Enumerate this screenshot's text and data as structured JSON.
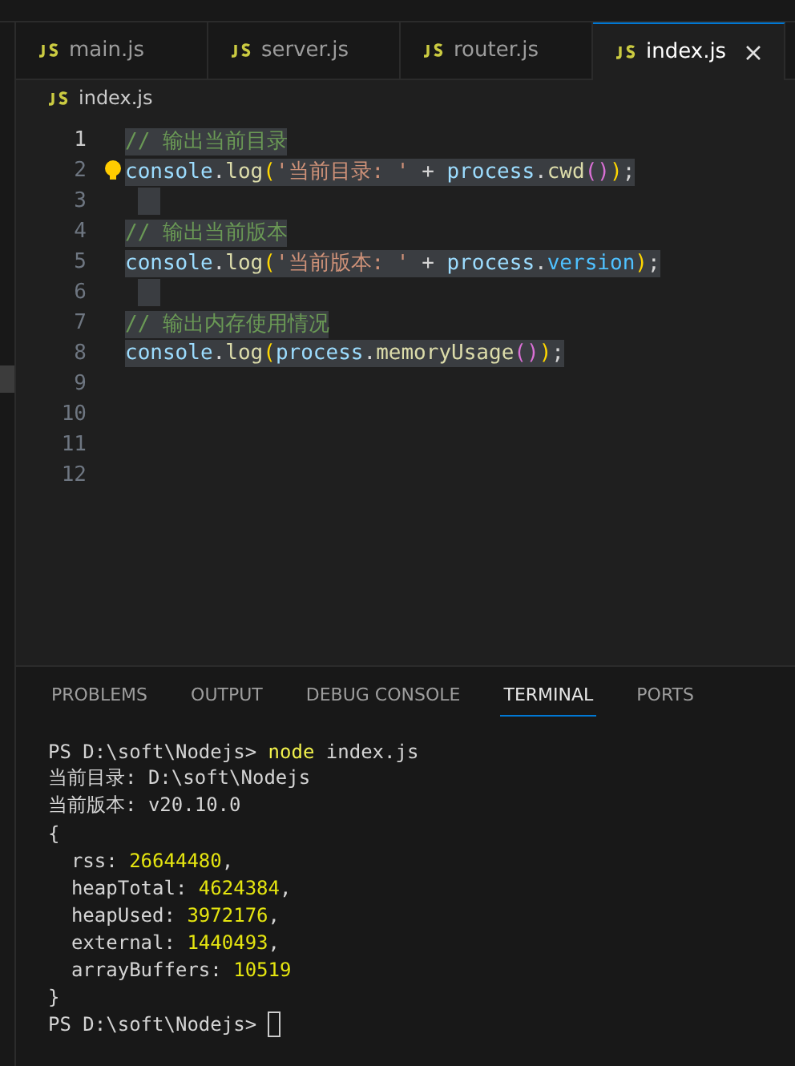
{
  "editor_tabs": [
    {
      "label": "main.js",
      "selected": false
    },
    {
      "label": "server.js",
      "selected": false
    },
    {
      "label": "router.js",
      "selected": false
    },
    {
      "label": "index.js",
      "selected": true
    }
  ],
  "breadcrumb": "index.js",
  "code_lines": [
    {
      "number": "1",
      "current": true,
      "selected": true,
      "tokens": [
        {
          "t": "// 输出当前目录",
          "kind": "comment"
        }
      ]
    },
    {
      "number": "2",
      "current": false,
      "selected": true,
      "lightbulb": true,
      "tokens": [
        {
          "t": "console",
          "kind": "var"
        },
        {
          "t": ".",
          "kind": "plain"
        },
        {
          "t": "log",
          "kind": "func"
        },
        {
          "t": "(",
          "kind": "bracket"
        },
        {
          "t": "'当前目录: '",
          "kind": "string"
        },
        {
          "t": " + ",
          "kind": "plain"
        },
        {
          "t": "process",
          "kind": "var"
        },
        {
          "t": ".",
          "kind": "plain"
        },
        {
          "t": "cwd",
          "kind": "func"
        },
        {
          "t": "()",
          "kind": "bracket2"
        },
        {
          "t": ")",
          "kind": "bracket"
        },
        {
          "t": ";",
          "kind": "plain"
        }
      ]
    },
    {
      "number": "3",
      "current": false,
      "selected": true
    },
    {
      "number": "4",
      "current": false,
      "selected": true,
      "tokens": [
        {
          "t": "// 输出当前版本",
          "kind": "comment"
        }
      ]
    },
    {
      "number": "5",
      "current": false,
      "selected": true,
      "tokens": [
        {
          "t": "console",
          "kind": "var"
        },
        {
          "t": ".",
          "kind": "plain"
        },
        {
          "t": "log",
          "kind": "func"
        },
        {
          "t": "(",
          "kind": "bracket"
        },
        {
          "t": "'当前版本: '",
          "kind": "string"
        },
        {
          "t": " + ",
          "kind": "plain"
        },
        {
          "t": "process",
          "kind": "var"
        },
        {
          "t": ".",
          "kind": "plain"
        },
        {
          "t": "version",
          "kind": "prop"
        },
        {
          "t": ")",
          "kind": "bracket"
        },
        {
          "t": ";",
          "kind": "plain"
        }
      ]
    },
    {
      "number": "6",
      "current": false,
      "selected": true
    },
    {
      "number": "7",
      "current": false,
      "selected": true,
      "tokens": [
        {
          "t": "// 输出内存使用情况",
          "kind": "comment"
        }
      ]
    },
    {
      "number": "8",
      "current": false,
      "selected": true,
      "tokens": [
        {
          "t": "console",
          "kind": "var"
        },
        {
          "t": ".",
          "kind": "plain"
        },
        {
          "t": "log",
          "kind": "func"
        },
        {
          "t": "(",
          "kind": "bracket"
        },
        {
          "t": "process",
          "kind": "var"
        },
        {
          "t": ".",
          "kind": "plain"
        },
        {
          "t": "memoryUsage",
          "kind": "func"
        },
        {
          "t": "()",
          "kind": "bracket2"
        },
        {
          "t": ")",
          "kind": "bracket"
        },
        {
          "t": ";",
          "kind": "plain"
        }
      ]
    },
    {
      "number": "9",
      "current": false,
      "selected": false
    },
    {
      "number": "10",
      "current": false,
      "selected": false
    },
    {
      "number": "11",
      "current": false,
      "selected": false
    },
    {
      "number": "12",
      "current": false,
      "selected": false
    }
  ],
  "panel_tabs": [
    {
      "label": "PROBLEMS",
      "selected": false
    },
    {
      "label": "OUTPUT",
      "selected": false
    },
    {
      "label": "DEBUG CONSOLE",
      "selected": false
    },
    {
      "label": "TERMINAL",
      "selected": true
    },
    {
      "label": "PORTS",
      "selected": false
    }
  ],
  "terminal_lines": [
    {
      "tokens": [
        {
          "t": "PS D:\\soft\\Nodejs> ",
          "kind": "plain"
        },
        {
          "t": "node",
          "kind": "cmd"
        },
        {
          "t": " index.js",
          "kind": "plain"
        }
      ]
    },
    {
      "tokens": [
        {
          "t": "当前目录: D:\\soft\\Nodejs",
          "kind": "plain"
        }
      ]
    },
    {
      "tokens": [
        {
          "t": "当前版本: v20.10.0",
          "kind": "plain"
        }
      ]
    },
    {
      "tokens": [
        {
          "t": "{",
          "kind": "plain"
        }
      ]
    },
    {
      "tokens": [
        {
          "t": "  rss: ",
          "kind": "plain"
        },
        {
          "t": "26644480",
          "kind": "num"
        },
        {
          "t": ",",
          "kind": "plain"
        }
      ]
    },
    {
      "tokens": [
        {
          "t": "  heapTotal: ",
          "kind": "plain"
        },
        {
          "t": "4624384",
          "kind": "num"
        },
        {
          "t": ",",
          "kind": "plain"
        }
      ]
    },
    {
      "tokens": [
        {
          "t": "  heapUsed: ",
          "kind": "plain"
        },
        {
          "t": "3972176",
          "kind": "num"
        },
        {
          "t": ",",
          "kind": "plain"
        }
      ]
    },
    {
      "tokens": [
        {
          "t": "  external: ",
          "kind": "plain"
        },
        {
          "t": "1440493",
          "kind": "num"
        },
        {
          "t": ",",
          "kind": "plain"
        }
      ]
    },
    {
      "tokens": [
        {
          "t": "  arrayBuffers: ",
          "kind": "plain"
        },
        {
          "t": "10519",
          "kind": "num"
        }
      ]
    },
    {
      "tokens": [
        {
          "t": "}",
          "kind": "plain"
        }
      ]
    },
    {
      "tokens": [
        {
          "t": "PS D:\\soft\\Nodejs> ",
          "kind": "plain"
        }
      ],
      "cursor": true
    }
  ]
}
